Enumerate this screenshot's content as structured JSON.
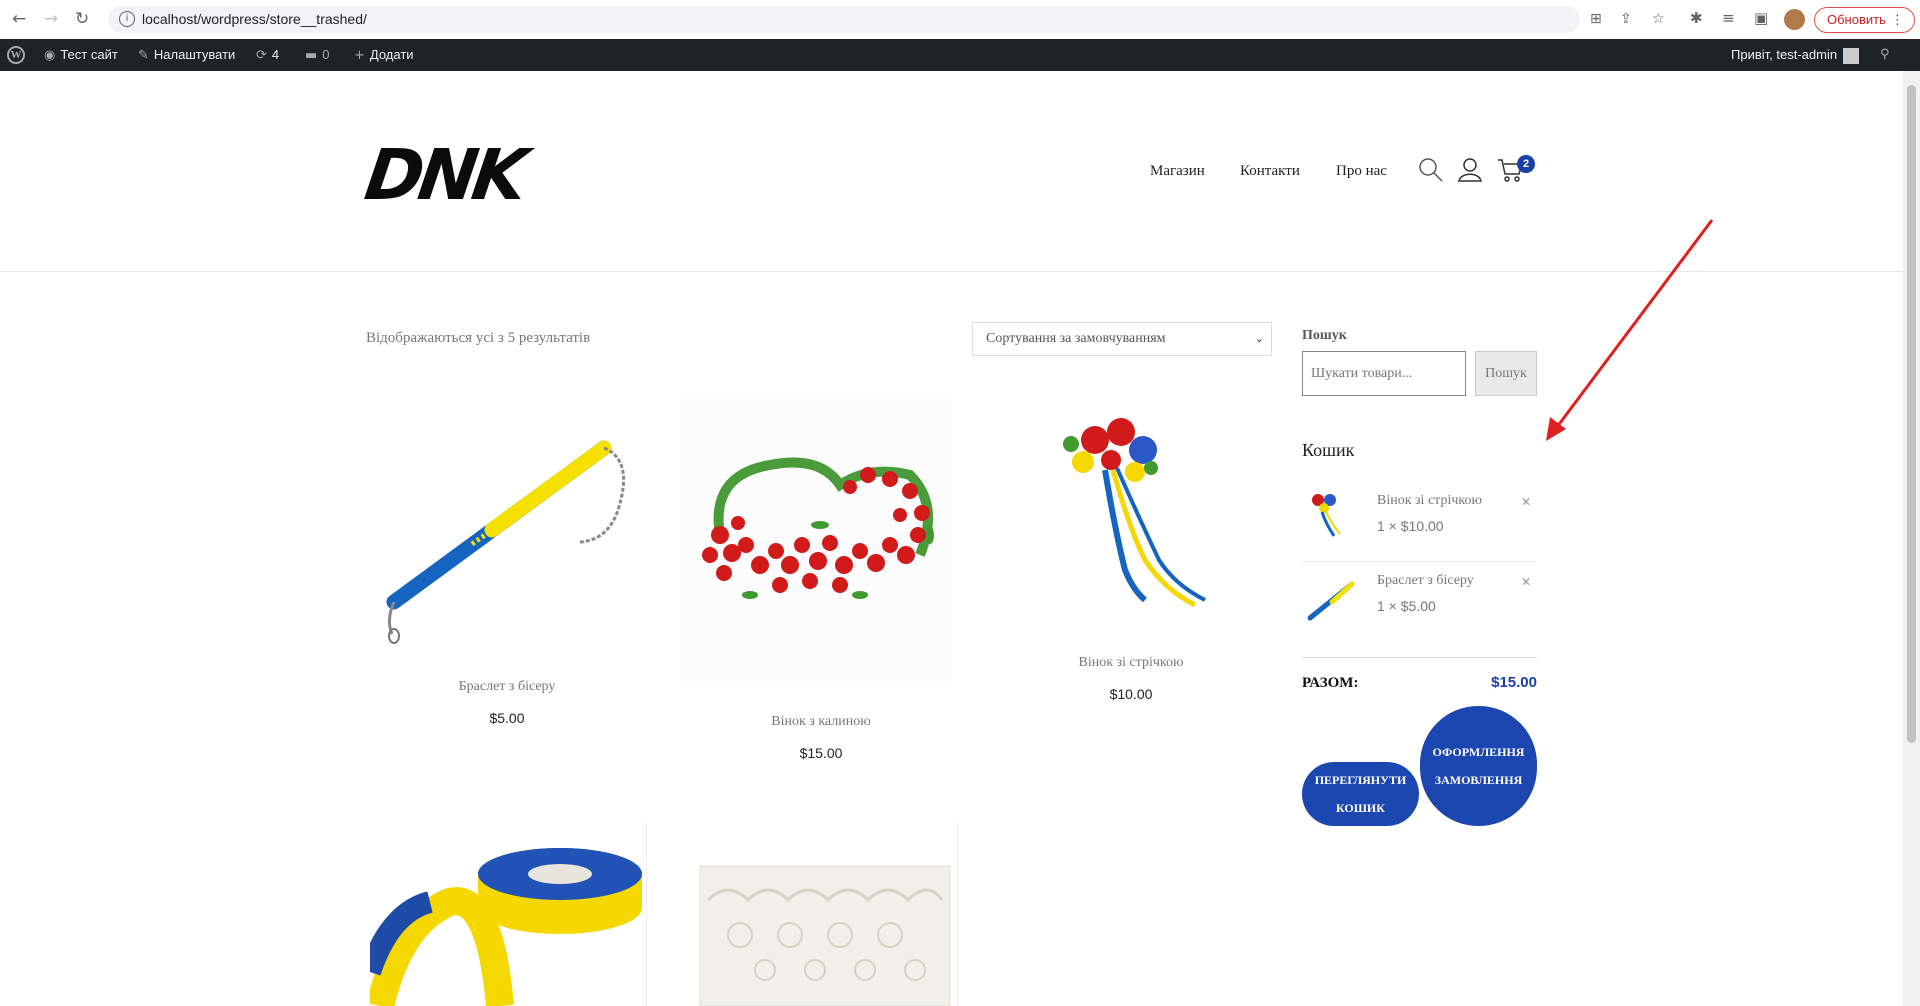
{
  "browser": {
    "url": "localhost/wordpress/store__trashed/",
    "update_label": "Обновить"
  },
  "admin_bar": {
    "site_name": "Тест сайт",
    "customize": "Налаштувати",
    "updates_count": "4",
    "comments_count": "0",
    "new_label": "Додати",
    "greeting": "Привіт, test-admin"
  },
  "header": {
    "logo_text": "DNK",
    "menu": [
      "Магазин",
      "Контакти",
      "Про нас"
    ],
    "cart_count": "2"
  },
  "shop": {
    "result_count": "Відображаються усі з 5 результатів",
    "sort_selected": "Сортування за замовчуванням",
    "products": [
      {
        "title": "Браслет з бісеру",
        "price": "$5.00"
      },
      {
        "title": "Вінок з калиною",
        "price": "$15.00"
      },
      {
        "title": "Вінок зі стрічкою",
        "price": "$10.00"
      },
      {
        "title": "",
        "price": ""
      },
      {
        "title": "",
        "price": ""
      }
    ]
  },
  "sidebar": {
    "search_heading": "Пошук",
    "search_placeholder": "Шукати товари...",
    "search_button": "Пошук",
    "cart_heading": "Кошик",
    "cart_items": [
      {
        "name": "Вінок зі стрічкою",
        "qty": "1 × $10.00"
      },
      {
        "name": "Браслет з бісеру",
        "qty": "1 × $5.00"
      }
    ],
    "total_label": "РАЗОМ:",
    "total_value": "$15.00",
    "view_cart": "ПЕРЕГЛЯНУТИ КОШИК",
    "checkout": "ОФОРМЛЕННЯ ЗАМОВЛЕННЯ"
  },
  "colors": {
    "accent": "#1d47b0",
    "admin_bar": "#1d23279",
    "annotation_arrow": "#e02020"
  }
}
